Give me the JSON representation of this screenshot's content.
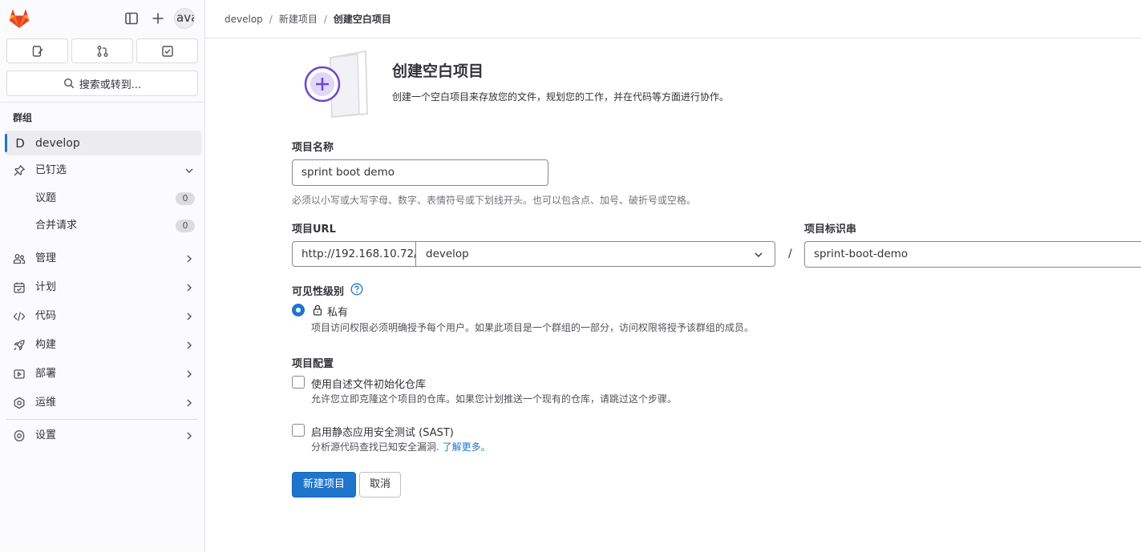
{
  "colors": {
    "accent": "#1f75cb",
    "brand_orange": "#fc6d26",
    "illustration_purple": "#6e49cb"
  },
  "sidebar": {
    "avatar_text": "ava",
    "search_label": "搜索或转到...",
    "section_title": "群组",
    "group": {
      "letter": "D",
      "name": "develop"
    },
    "pinned": {
      "label": "已钉选",
      "items": [
        {
          "label": "议题",
          "count": "0"
        },
        {
          "label": "合并请求",
          "count": "0"
        }
      ]
    },
    "nav": [
      {
        "label": "管理",
        "icon": "users-icon"
      },
      {
        "label": "计划",
        "icon": "calendar-icon"
      },
      {
        "label": "代码",
        "icon": "code-icon"
      },
      {
        "label": "构建",
        "icon": "rocket-icon"
      },
      {
        "label": "部署",
        "icon": "deploy-icon"
      },
      {
        "label": "运维",
        "icon": "monitor-icon"
      },
      {
        "label": "设置",
        "icon": "gear-icon"
      }
    ]
  },
  "breadcrumb": {
    "items": [
      "develop",
      "新建项目"
    ],
    "current": "创建空白项目"
  },
  "header": {
    "title": "创建空白项目",
    "description": "创建一个空白项目来存放您的文件，规划您的工作，并在代码等方面进行协作。"
  },
  "form": {
    "name_label": "项目名称",
    "name_value": "sprint boot demo",
    "name_help": "必须以小写或大写字母、数字、表情符号或下划线开头。也可以包含点、加号、破折号或空格。",
    "url_label": "项目URL",
    "url_prefix": "http://192.168.10.72/",
    "url_group": "develop",
    "url_separator": "/",
    "slug_label": "项目标识串",
    "slug_value": "sprint-boot-demo",
    "visibility_label": "可见性级别",
    "visibility_option": "私有",
    "visibility_desc": "项目访问权限必须明确授予每个用户。如果此项目是一个群组的一部分，访问权限将授予该群组的成员。",
    "config_label": "项目配置",
    "readme_label": "使用自述文件初始化仓库",
    "readme_desc": "允许您立即克隆这个项目的仓库。如果您计划推送一个现有的仓库，请跳过这个步骤。",
    "sast_label": "启用静态应用安全测试 (SAST)",
    "sast_desc": "分析源代码查找已知安全漏洞.",
    "sast_link": "了解更多。",
    "submit_label": "新建项目",
    "cancel_label": "取消"
  }
}
